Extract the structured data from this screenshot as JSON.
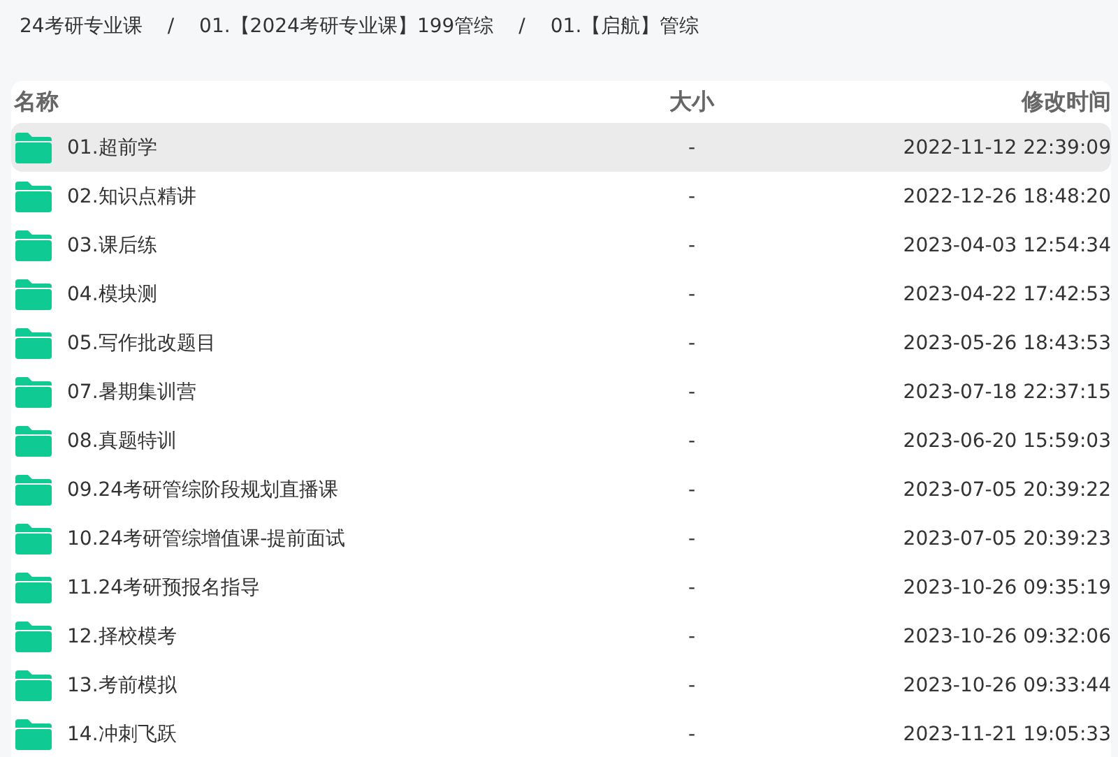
{
  "breadcrumb": {
    "items": [
      "24考研专业课",
      "01.【2024考研专业课】199管综",
      "01.【启航】管综"
    ],
    "separators": [
      "/",
      "/"
    ]
  },
  "table": {
    "columns": [
      "名称",
      "大小",
      "修改时间"
    ],
    "rows": [
      {
        "name": "01.超前学",
        "size": "-",
        "modified": "2022-11-12 22:39:09",
        "selected": true
      },
      {
        "name": "02.知识点精讲",
        "size": "-",
        "modified": "2022-12-26 18:48:20",
        "selected": false
      },
      {
        "name": "03.课后练",
        "size": "-",
        "modified": "2023-04-03 12:54:34",
        "selected": false
      },
      {
        "name": "04.模块测",
        "size": "-",
        "modified": "2023-04-22 17:42:53",
        "selected": false
      },
      {
        "name": "05.写作批改题目",
        "size": "-",
        "modified": "2023-05-26 18:43:53",
        "selected": false
      },
      {
        "name": "07.暑期集训营",
        "size": "-",
        "modified": "2023-07-18 22:37:15",
        "selected": false
      },
      {
        "name": "08.真题特训",
        "size": "-",
        "modified": "2023-06-20 15:59:03",
        "selected": false
      },
      {
        "name": "09.24考研管综阶段规划直播课",
        "size": "-",
        "modified": "2023-07-05 20:39:22",
        "selected": false
      },
      {
        "name": "10.24考研管综增值课-提前面试",
        "size": "-",
        "modified": "2023-07-05 20:39:23",
        "selected": false
      },
      {
        "name": "11.24考研预报名指导",
        "size": "-",
        "modified": "2023-10-26 09:35:19",
        "selected": false
      },
      {
        "name": "12.择校模考",
        "size": "-",
        "modified": "2023-10-26 09:32:06",
        "selected": false
      },
      {
        "name": "13.考前模拟",
        "size": "-",
        "modified": "2023-10-26 09:33:44",
        "selected": false
      },
      {
        "name": "14.冲刺飞跃",
        "size": "-",
        "modified": "2023-11-21 19:05:33",
        "selected": false
      }
    ]
  }
}
